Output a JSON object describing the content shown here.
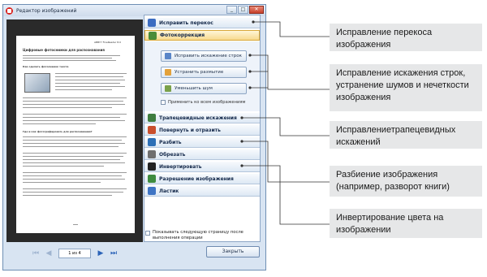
{
  "window": {
    "title": "Редактор изображений",
    "close_glyph": "✕",
    "minimize_glyph": "_",
    "maximize_glyph": "□"
  },
  "preview_page": {
    "header": "ABBYY FineReader 8.0",
    "heading": "Цифровые фотоснимки для распознавания",
    "subheading": "Как сделать фотоснимок текста",
    "section2": "Где и как фотографировать для распознавания?"
  },
  "navigation": {
    "first": "⏮",
    "prev": "◀",
    "page_indicator": "1 из 4",
    "next": "▶",
    "last": "⏭"
  },
  "sections": [
    {
      "label": "Исправить перекос",
      "color": "#3b6cc1"
    },
    {
      "label": "Фотокоррекция",
      "color": "#4a8c3a"
    }
  ],
  "photo_buttons": [
    {
      "label": "Исправить искажение строк",
      "color": "#5a86c8"
    },
    {
      "label": "Устранить размытие",
      "color": "#e3a13a"
    },
    {
      "label": "Уменьшить шум",
      "color": "#7aa14a"
    }
  ],
  "apply_all_label": "Применить ко всем изображениям",
  "tools": [
    {
      "label": "Трапецевидные искажения",
      "color": "#3f7d3f"
    },
    {
      "label": "Повернуть и отразить",
      "color": "#c94f2d"
    },
    {
      "label": "Разбить",
      "color": "#2c6fb6"
    },
    {
      "label": "Обрезать",
      "color": "#6f6f6f"
    },
    {
      "label": "Инвертировать",
      "color": "#222222"
    },
    {
      "label": "Разрешение изображения",
      "color": "#3f8c3f"
    },
    {
      "label": "Ластик",
      "color": "#3e74c4"
    }
  ],
  "show_next_label": "Показывать следующую страницу после выполнения операции",
  "close_button": "Закрыть",
  "callouts": [
    "Исправление перекоса изображения",
    "Исправление искажения строк, устранение шумов и нечеткости изображения",
    "Исправлениетрапецевидных искажений",
    "Разбиение изображения (например, разворот книги)",
    "Инвертирование цвета на изображении"
  ]
}
